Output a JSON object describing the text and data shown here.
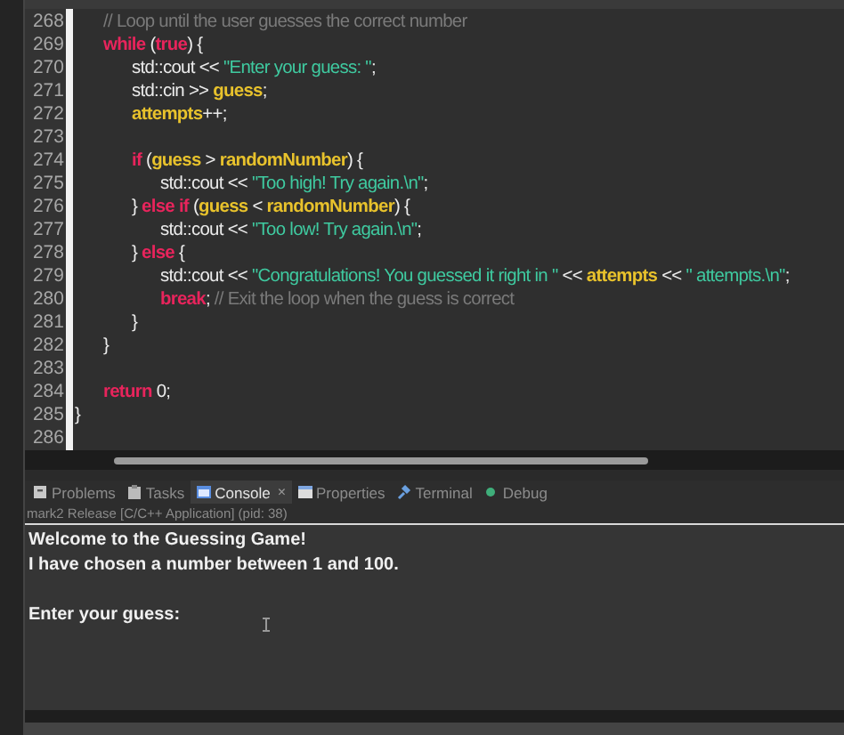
{
  "editor": {
    "lines": [
      {
        "children": [
          {
            "number": "268",
            "tokens": [
              {
                "kind": "comment",
                "text": "// Loop until the user guesses the correct number"
              }
            ]
          },
          {
            "number": "269",
            "tokens": [
              {
                "kind": "keyword",
                "text": "while"
              },
              {
                "kind": "plain",
                "text": " ("
              },
              {
                "kind": "keyword",
                "text": "true"
              },
              {
                "kind": "plain",
                "text": ") {"
              }
            ]
          },
          {
            "children": [
              {
                "number": "270",
                "tokens": [
                  {
                    "kind": "plain",
                    "text": "std::cout << "
                  },
                  {
                    "kind": "string",
                    "text": "\"Enter your guess: \""
                  },
                  {
                    "kind": "plain",
                    "text": ";"
                  }
                ]
              },
              {
                "number": "271",
                "tokens": [
                  {
                    "kind": "plain",
                    "text": "std::cin >> "
                  },
                  {
                    "kind": "ident",
                    "text": "guess"
                  },
                  {
                    "kind": "plain",
                    "text": ";"
                  }
                ]
              },
              {
                "number": "272",
                "tokens": [
                  {
                    "kind": "ident",
                    "text": "attempts"
                  },
                  {
                    "kind": "plain",
                    "text": "++;"
                  }
                ]
              },
              {
                "number": "273"
              },
              {
                "number": "274",
                "tokens": [
                  {
                    "kind": "keyword",
                    "text": "if"
                  },
                  {
                    "kind": "plain",
                    "text": " ("
                  },
                  {
                    "kind": "ident",
                    "text": "guess"
                  },
                  {
                    "kind": "plain",
                    "text": " > "
                  },
                  {
                    "kind": "ident",
                    "text": "randomNumber"
                  },
                  {
                    "kind": "plain",
                    "text": ") {"
                  }
                ]
              },
              {
                "children": [
                  {
                    "number": "275",
                    "tokens": [
                      {
                        "kind": "plain",
                        "text": "std::cout << "
                      },
                      {
                        "kind": "string",
                        "text": "\"Too high! Try again.\\n\""
                      },
                      {
                        "kind": "plain",
                        "text": ";"
                      }
                    ]
                  }
                ]
              },
              {
                "number": "276",
                "tokens": [
                  {
                    "kind": "plain",
                    "text": "} "
                  },
                  {
                    "kind": "keyword",
                    "text": "else if"
                  },
                  {
                    "kind": "plain",
                    "text": " ("
                  },
                  {
                    "kind": "ident",
                    "text": "guess"
                  },
                  {
                    "kind": "plain",
                    "text": " < "
                  },
                  {
                    "kind": "ident",
                    "text": "randomNumber"
                  },
                  {
                    "kind": "plain",
                    "text": ") {"
                  }
                ]
              },
              {
                "children": [
                  {
                    "number": "277",
                    "tokens": [
                      {
                        "kind": "plain",
                        "text": "std::cout << "
                      },
                      {
                        "kind": "string",
                        "text": "\"Too low! Try again.\\n\""
                      },
                      {
                        "kind": "plain",
                        "text": ";"
                      }
                    ]
                  }
                ]
              },
              {
                "number": "278",
                "tokens": [
                  {
                    "kind": "plain",
                    "text": "} "
                  },
                  {
                    "kind": "keyword",
                    "text": "else"
                  },
                  {
                    "kind": "plain",
                    "text": " {"
                  }
                ]
              },
              {
                "children": [
                  {
                    "number": "279",
                    "tokens": [
                      {
                        "kind": "plain",
                        "text": "std::cout << "
                      },
                      {
                        "kind": "string",
                        "text": "\"Congratulations! You guessed it right in \""
                      },
                      {
                        "kind": "plain",
                        "text": " << "
                      },
                      {
                        "kind": "ident",
                        "text": "attempts"
                      },
                      {
                        "kind": "plain",
                        "text": " << "
                      },
                      {
                        "kind": "string",
                        "text": "\" attempts.\\n\""
                      },
                      {
                        "kind": "plain",
                        "text": ";"
                      }
                    ]
                  },
                  {
                    "number": "280",
                    "tokens": [
                      {
                        "kind": "keyword",
                        "text": "break"
                      },
                      {
                        "kind": "plain",
                        "text": ";"
                      },
                      {
                        "kind": "comment",
                        "text": " // Exit the loop when the guess is correct"
                      }
                    ]
                  }
                ]
              },
              {
                "number": "281",
                "tokens": [
                  {
                    "kind": "plain",
                    "text": "}"
                  }
                ]
              }
            ]
          },
          {
            "number": "282",
            "tokens": [
              {
                "kind": "plain",
                "text": "}"
              }
            ]
          },
          {
            "number": "283"
          },
          {
            "number": "284",
            "tokens": [
              {
                "kind": "keyword",
                "text": "return"
              },
              {
                "kind": "plain",
                "text": " 0;"
              }
            ]
          }
        ]
      },
      {
        "number": "285",
        "tokens": [
          {
            "kind": "plain",
            "text": "}"
          }
        ]
      },
      {
        "number": "286"
      }
    ]
  },
  "panel": {
    "tabs": [
      {
        "label": "Problems",
        "kind": "problems",
        "selected": false
      },
      {
        "label": "Tasks",
        "kind": "tasks",
        "selected": false
      },
      {
        "label": "Console",
        "kind": "console",
        "selected": true,
        "close": "×"
      },
      {
        "label": "Properties",
        "kind": "properties",
        "selected": false
      },
      {
        "label": "Terminal",
        "kind": "terminal",
        "selected": false
      },
      {
        "label": "Debug",
        "kind": "debug",
        "selected": false
      }
    ],
    "process": "mark2 Release [C/C++ Application]  (pid: 38)",
    "console_lines": [
      {
        "text": "Welcome to the Guessing Game!",
        "blank_before": false
      },
      {
        "text": "I have chosen a number between 1 and 100.",
        "blank_before": false
      },
      {
        "text": "Enter your guess:",
        "blank_before": true
      }
    ]
  }
}
